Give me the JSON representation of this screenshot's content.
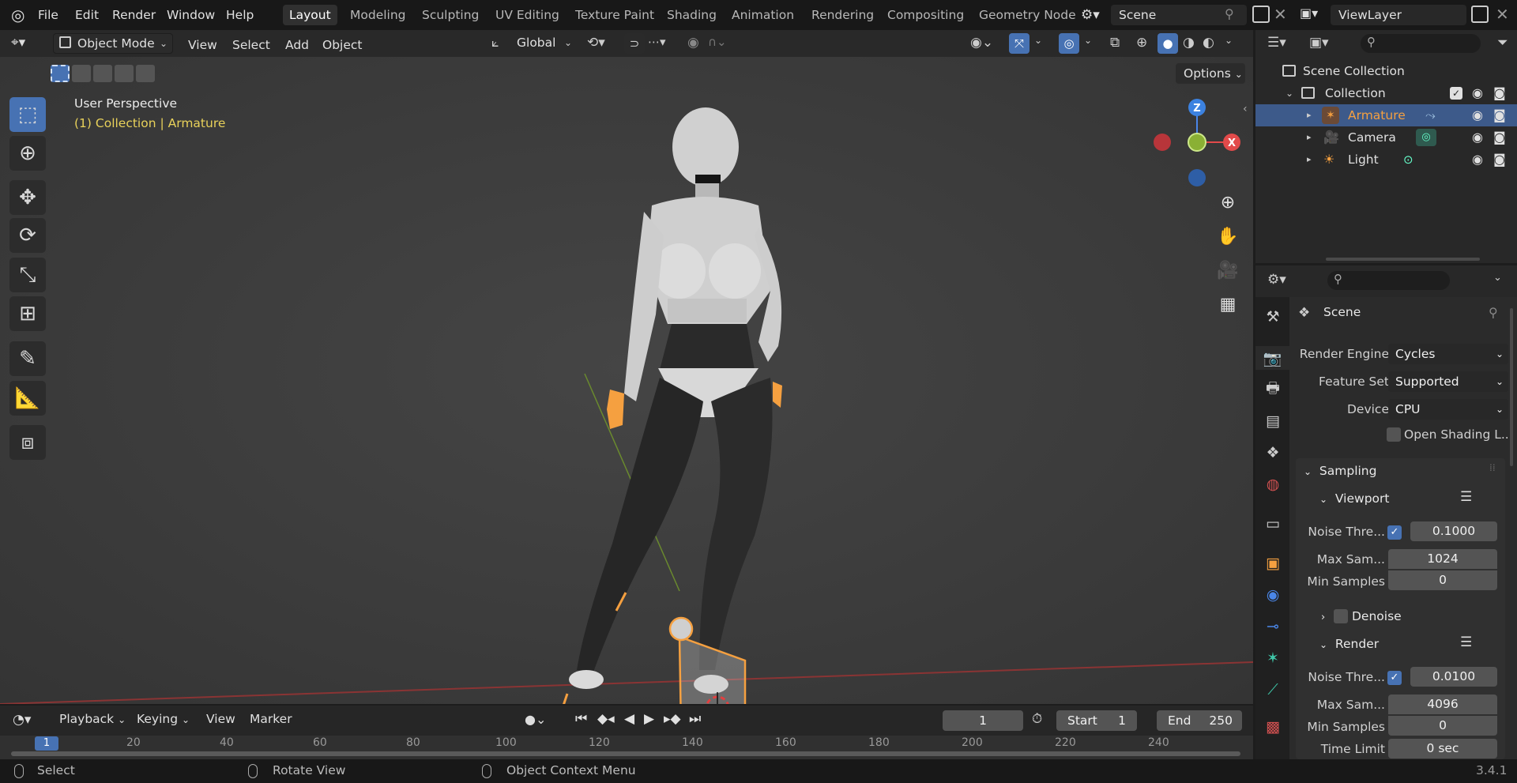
{
  "topbar": {
    "menus": [
      "File",
      "Edit",
      "Render",
      "Window",
      "Help"
    ],
    "workspaces": [
      "Layout",
      "Modeling",
      "Sculpting",
      "UV Editing",
      "Texture Paint",
      "Shading",
      "Animation",
      "Rendering",
      "Compositing",
      "Geometry Node"
    ],
    "active_workspace": "Layout",
    "scene_name": "Scene",
    "view_layer": "ViewLayer"
  },
  "viewport_header": {
    "mode": "Object Mode",
    "menus": [
      "View",
      "Select",
      "Add",
      "Object"
    ],
    "transform_orientation": "Global",
    "options_label": "Options"
  },
  "viewport": {
    "view_name": "User Perspective",
    "context": "(1) Collection | Armature",
    "gizmo_axes": {
      "x": "X",
      "y": "Y",
      "z": "Z"
    }
  },
  "outliner": {
    "root": "Scene Collection",
    "collection": "Collection",
    "items": [
      {
        "label": "Armature",
        "icon": "armature-icon",
        "selected": true
      },
      {
        "label": "Camera",
        "icon": "camera-icon",
        "selected": false
      },
      {
        "label": "Light",
        "icon": "light-icon",
        "selected": false
      }
    ]
  },
  "properties": {
    "title": "Scene",
    "render_engine_label": "Render Engine",
    "render_engine": "Cycles",
    "feature_set_label": "Feature Set",
    "feature_set": "Supported",
    "device_label": "Device",
    "device": "CPU",
    "osl_label": "Open Shading L...",
    "sampling_label": "Sampling",
    "viewport_label": "Viewport",
    "vp_noise_label": "Noise Thre...",
    "vp_noise": "0.1000",
    "vp_max_label": "Max Sam...",
    "vp_max": "1024",
    "vp_min_label": "Min Samples",
    "vp_min": "0",
    "denoise_label": "Denoise",
    "render_label": "Render",
    "r_noise_label": "Noise Thre...",
    "r_noise": "0.0100",
    "r_max_label": "Max Sam...",
    "r_max": "4096",
    "r_min_label": "Min Samples",
    "r_min": "0",
    "time_limit_label": "Time Limit",
    "time_limit": "0 sec"
  },
  "timeline": {
    "menus": [
      "Playback",
      "Keying",
      "View",
      "Marker"
    ],
    "current_frame": "1",
    "start_label": "Start",
    "start": "1",
    "end_label": "End",
    "end": "250",
    "ruler": [
      "1",
      "20",
      "40",
      "60",
      "80",
      "100",
      "120",
      "140",
      "160",
      "180",
      "200",
      "220",
      "240"
    ]
  },
  "statusbar": {
    "select": "Select",
    "rotate": "Rotate View",
    "context_menu": "Object Context Menu",
    "version": "3.4.1"
  },
  "colors": {
    "accent": "#4772b3",
    "selection_orange": "#f5a040",
    "context_yellow": "#e8d15a"
  }
}
